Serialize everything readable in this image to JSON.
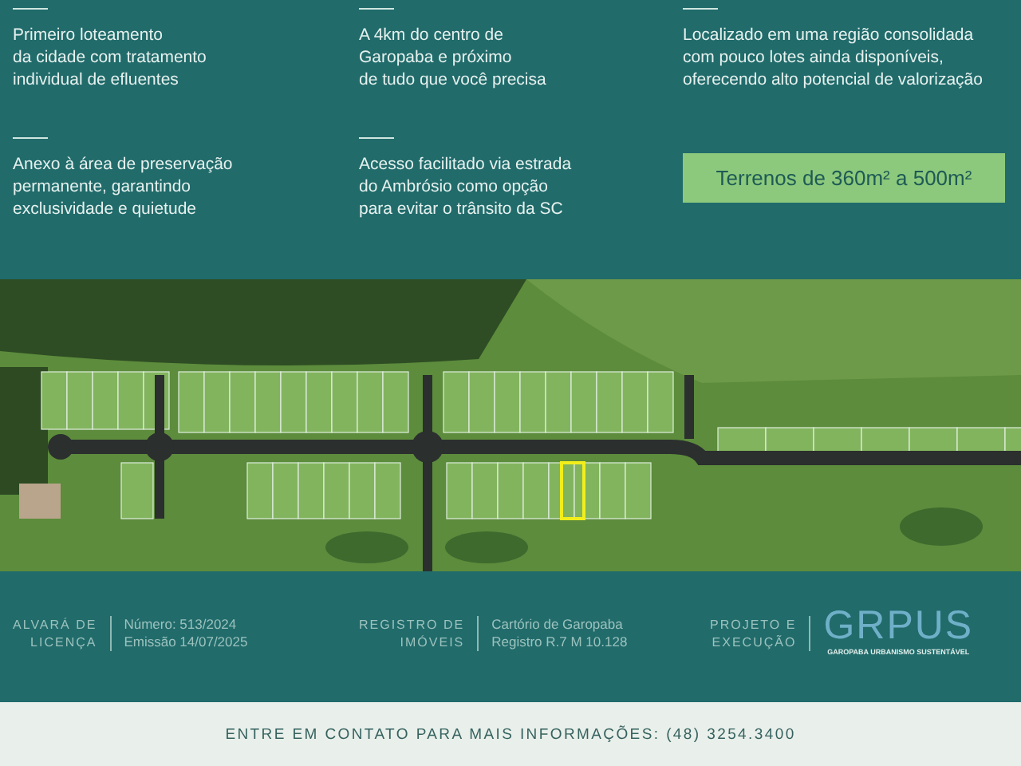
{
  "features": [
    {
      "lines": [
        "Primeiro loteamento",
        "da cidade com tratamento",
        "individual de efluentes"
      ]
    },
    {
      "lines": [
        "A 4km do centro de",
        "Garopaba e próximo",
        "de tudo que você precisa"
      ]
    },
    {
      "lines": [
        "Localizado em uma região consolidada",
        "com pouco lotes ainda disponíveis,",
        "oferecendo alto potencial de valorização"
      ]
    },
    {
      "lines": [
        "Anexo à área de preservação",
        "permanente, garantindo",
        "exclusividade e quietude"
      ]
    },
    {
      "lines": [
        "Acesso facilitado via estrada",
        "do Ambrósio como opção",
        "para evitar o trânsito da SC"
      ]
    }
  ],
  "size_badge": "Terrenos de 360m² a 500m²",
  "info": [
    {
      "label": [
        "ALVARÁ DE",
        "LICENÇA"
      ],
      "value": [
        "Número: 513/2024",
        "Emissão 14/07/2025"
      ]
    },
    {
      "label": [
        "REGISTRO DE",
        "IMÓVEIS"
      ],
      "value": [
        "Cartório de Garopaba",
        "Registro R.7 M 10.128"
      ]
    },
    {
      "label": [
        "PROJETO E",
        "EXECUÇÃO"
      ]
    }
  ],
  "logo": {
    "name": "GRPUS",
    "tagline": "GAROPABA URBANISMO SUSTENTÁVEL"
  },
  "contact": "ENTRE EM CONTATO PARA MAIS INFORMAÇÕES: (48) 3254.3400"
}
